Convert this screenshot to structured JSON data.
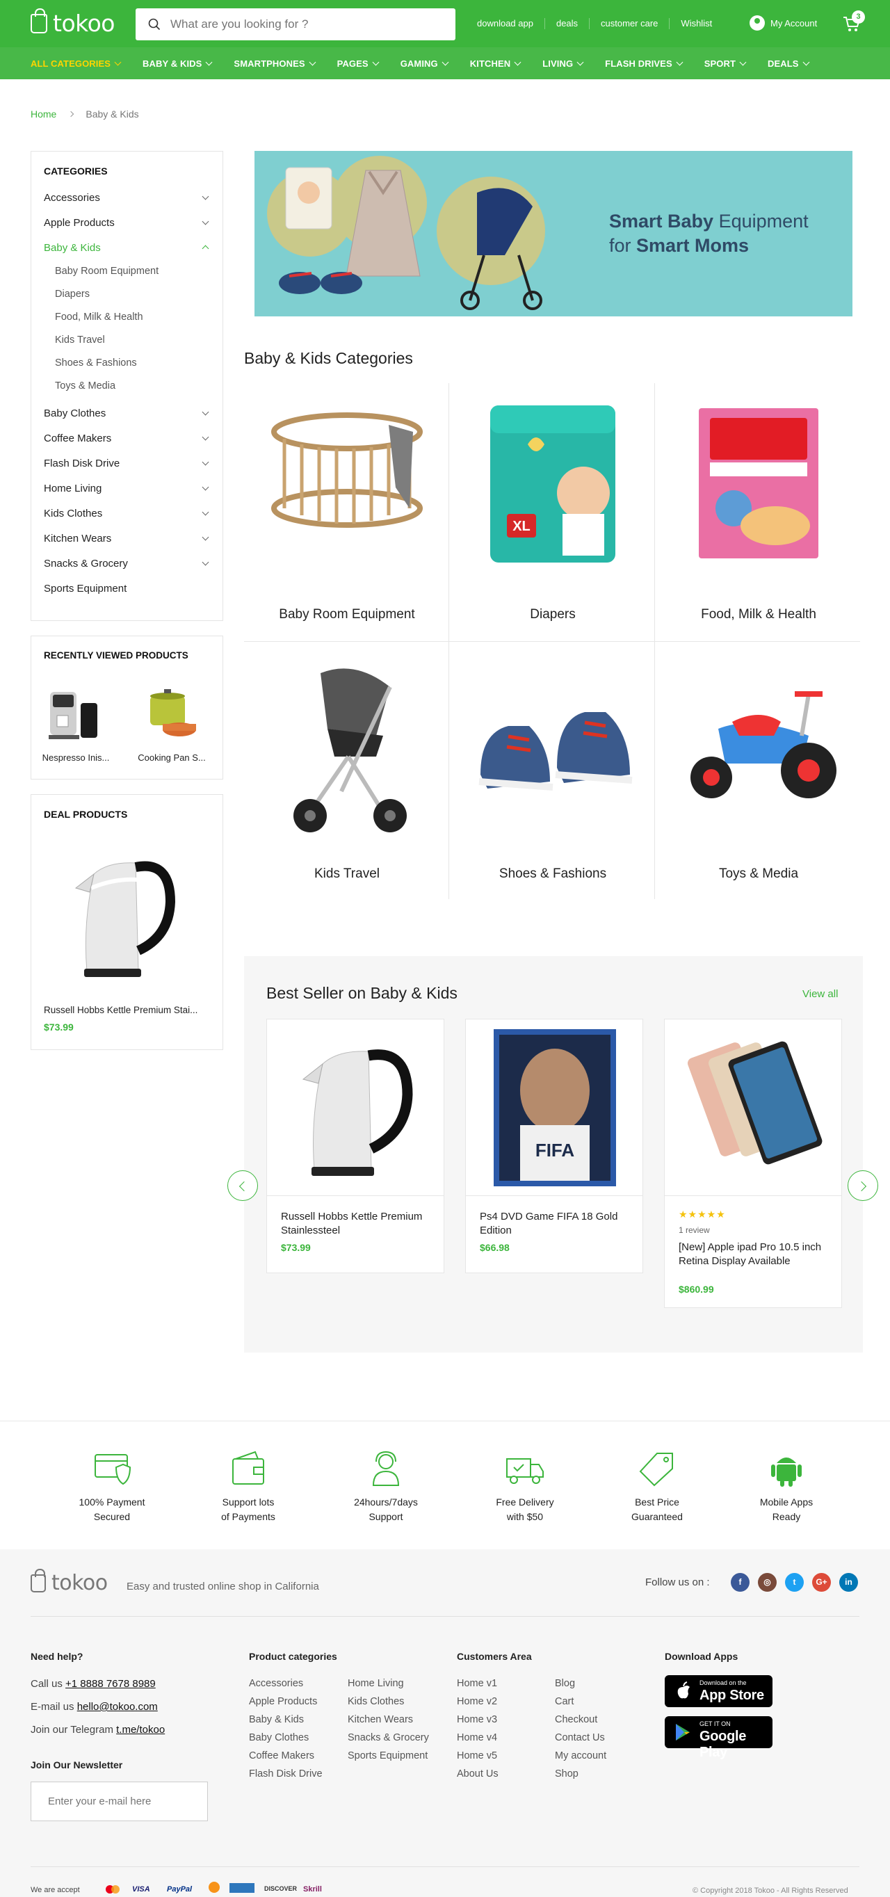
{
  "header": {
    "brand": "tokoo",
    "search_placeholder": "What are you looking for ?",
    "top_links": [
      "download app",
      "deals",
      "customer care",
      "Wishlist"
    ],
    "account_label": "My Account",
    "cart_count": "3"
  },
  "nav": [
    {
      "label": "ALL CATEGORIES",
      "active": true
    },
    {
      "label": "BABY & KIDS"
    },
    {
      "label": "SMARTPHONES"
    },
    {
      "label": "PAGES"
    },
    {
      "label": "GAMING"
    },
    {
      "label": "KITCHEN"
    },
    {
      "label": "LIVING"
    },
    {
      "label": "FLASH DRIVES"
    },
    {
      "label": "SPORT"
    },
    {
      "label": "DEALS"
    }
  ],
  "breadcrumb": {
    "home": "Home",
    "current": "Baby & Kids"
  },
  "sidebar": {
    "categories_title": "CATEGORIES",
    "categories": [
      {
        "label": "Accessories",
        "chevron": true
      },
      {
        "label": "Apple Products",
        "chevron": true
      },
      {
        "label": "Baby & Kids",
        "chevron": true,
        "open": true
      },
      {
        "label": "Baby Clothes",
        "chevron": true
      },
      {
        "label": "Coffee Makers",
        "chevron": true
      },
      {
        "label": "Flash Disk Drive",
        "chevron": true
      },
      {
        "label": "Home Living",
        "chevron": true
      },
      {
        "label": "Kids Clothes",
        "chevron": true
      },
      {
        "label": "Kitchen Wears",
        "chevron": true
      },
      {
        "label": "Snacks & Grocery",
        "chevron": true
      },
      {
        "label": "Sports Equipment",
        "chevron": false
      }
    ],
    "subcategories": [
      "Baby Room Equipment",
      "Diapers",
      "Food, Milk & Health",
      "Kids Travel",
      "Shoes & Fashions",
      "Toys & Media"
    ],
    "recent_title": "RECENTLY VIEWED PRODUCTS",
    "recent": [
      "Nespresso Inis...",
      "Cooking Pan S..."
    ],
    "deal_title": "DEAL PRODUCTS",
    "deal": {
      "name": "Russell Hobbs Kettle Premium Stai...",
      "price": "$73.99"
    }
  },
  "banner": {
    "bold1": "Smart Baby",
    "rest1": " Equipment",
    "pre2": "for ",
    "bold2": "Smart Moms"
  },
  "category_section": {
    "title": "Baby & Kids Categories",
    "items": [
      "Baby Room Equipment",
      "Diapers",
      "Food, Milk & Health",
      "Kids Travel",
      "Shoes & Fashions",
      "Toys & Media"
    ]
  },
  "best_seller": {
    "title": "Best Seller on Baby & Kids",
    "view_all": "View all",
    "products": [
      {
        "name": "Russell Hobbs Kettle Premium Stainlessteel",
        "price": "$73.99"
      },
      {
        "name": "Ps4 DVD Game FIFA 18 Gold Edition",
        "price": "$66.98"
      },
      {
        "name": "[New] Apple ipad Pro 10.5 inch Retina Display Available",
        "price": "$860.99",
        "rating": 5,
        "reviews": "1 review"
      }
    ]
  },
  "features": [
    {
      "line1": "100% Payment",
      "line2": "Secured",
      "icon": "card-shield-icon"
    },
    {
      "line1": "Support lots",
      "line2": "of Payments",
      "icon": "wallet-icon"
    },
    {
      "line1": "24hours/7days",
      "line2": "Support",
      "icon": "support-agent-icon"
    },
    {
      "line1": "Free Delivery",
      "line2": "with $50",
      "icon": "truck-icon"
    },
    {
      "line1": "Best Price",
      "line2": "Guaranteed",
      "icon": "price-tag-icon"
    },
    {
      "line1": "Mobile Apps",
      "line2": "Ready",
      "icon": "android-icon"
    }
  ],
  "footer": {
    "tagline": "Easy and trusted online shop in California",
    "follow": "Follow us on :",
    "help_title": "Need help?",
    "call_prefix": "Call us ",
    "phone": "+1 8888 7678 8989",
    "email_prefix": "E-mail us ",
    "email": "hello@tokoo.com",
    "telegram_prefix": "Join our Telegram ",
    "telegram": "t.me/tokoo",
    "newsletter_title": "Join Our Newsletter",
    "newsletter_placeholder": "Enter your e-mail here",
    "product_title": "Product categories",
    "product_col1": [
      "Accessories",
      "Apple Products",
      "Baby & Kids",
      "Baby Clothes",
      "Coffee Makers",
      "Flash Disk Drive"
    ],
    "product_col2": [
      "Home Living",
      "Kids Clothes",
      "Kitchen Wears",
      "Snacks & Grocery",
      "Sports Equipment"
    ],
    "customers_title": "Customers Area",
    "customers_col1": [
      "Home v1",
      "Home v2",
      "Home v3",
      "Home v4",
      "Home v5",
      "About Us"
    ],
    "customers_col2": [
      "Blog",
      "Cart",
      "Checkout",
      "Contact Us",
      "My account",
      "Shop"
    ],
    "apps_title": "Download Apps",
    "appstore_small": "Download on the",
    "appstore_big": "App Store",
    "gplay_small": "GET IT ON",
    "gplay_big": "Google Play",
    "accept": "We are accept",
    "payments": [
      "VISA",
      "PayPal",
      "DISCOVER",
      "Skrill"
    ],
    "copyright": "© Copyright 2018 Tokoo - All Rights Reserved"
  },
  "colors": {
    "brand_green": "#3cb53c",
    "nav_green": "#48b848",
    "active_nav": "#ffd400"
  }
}
